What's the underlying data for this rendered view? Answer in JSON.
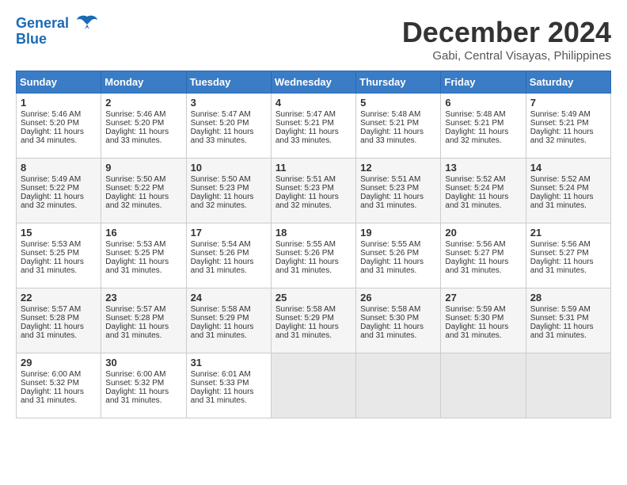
{
  "logo": {
    "line1": "General",
    "line2": "Blue"
  },
  "title": "December 2024",
  "location": "Gabi, Central Visayas, Philippines",
  "headers": [
    "Sunday",
    "Monday",
    "Tuesday",
    "Wednesday",
    "Thursday",
    "Friday",
    "Saturday"
  ],
  "weeks": [
    [
      {
        "day": "1",
        "sunrise": "5:46 AM",
        "sunset": "5:20 PM",
        "daylight": "11 hours and 34 minutes."
      },
      {
        "day": "2",
        "sunrise": "5:46 AM",
        "sunset": "5:20 PM",
        "daylight": "11 hours and 33 minutes."
      },
      {
        "day": "3",
        "sunrise": "5:47 AM",
        "sunset": "5:20 PM",
        "daylight": "11 hours and 33 minutes."
      },
      {
        "day": "4",
        "sunrise": "5:47 AM",
        "sunset": "5:21 PM",
        "daylight": "11 hours and 33 minutes."
      },
      {
        "day": "5",
        "sunrise": "5:48 AM",
        "sunset": "5:21 PM",
        "daylight": "11 hours and 33 minutes."
      },
      {
        "day": "6",
        "sunrise": "5:48 AM",
        "sunset": "5:21 PM",
        "daylight": "11 hours and 32 minutes."
      },
      {
        "day": "7",
        "sunrise": "5:49 AM",
        "sunset": "5:21 PM",
        "daylight": "11 hours and 32 minutes."
      }
    ],
    [
      {
        "day": "8",
        "sunrise": "5:49 AM",
        "sunset": "5:22 PM",
        "daylight": "11 hours and 32 minutes."
      },
      {
        "day": "9",
        "sunrise": "5:50 AM",
        "sunset": "5:22 PM",
        "daylight": "11 hours and 32 minutes."
      },
      {
        "day": "10",
        "sunrise": "5:50 AM",
        "sunset": "5:23 PM",
        "daylight": "11 hours and 32 minutes."
      },
      {
        "day": "11",
        "sunrise": "5:51 AM",
        "sunset": "5:23 PM",
        "daylight": "11 hours and 32 minutes."
      },
      {
        "day": "12",
        "sunrise": "5:51 AM",
        "sunset": "5:23 PM",
        "daylight": "11 hours and 31 minutes."
      },
      {
        "day": "13",
        "sunrise": "5:52 AM",
        "sunset": "5:24 PM",
        "daylight": "11 hours and 31 minutes."
      },
      {
        "day": "14",
        "sunrise": "5:52 AM",
        "sunset": "5:24 PM",
        "daylight": "11 hours and 31 minutes."
      }
    ],
    [
      {
        "day": "15",
        "sunrise": "5:53 AM",
        "sunset": "5:25 PM",
        "daylight": "11 hours and 31 minutes."
      },
      {
        "day": "16",
        "sunrise": "5:53 AM",
        "sunset": "5:25 PM",
        "daylight": "11 hours and 31 minutes."
      },
      {
        "day": "17",
        "sunrise": "5:54 AM",
        "sunset": "5:26 PM",
        "daylight": "11 hours and 31 minutes."
      },
      {
        "day": "18",
        "sunrise": "5:55 AM",
        "sunset": "5:26 PM",
        "daylight": "11 hours and 31 minutes."
      },
      {
        "day": "19",
        "sunrise": "5:55 AM",
        "sunset": "5:26 PM",
        "daylight": "11 hours and 31 minutes."
      },
      {
        "day": "20",
        "sunrise": "5:56 AM",
        "sunset": "5:27 PM",
        "daylight": "11 hours and 31 minutes."
      },
      {
        "day": "21",
        "sunrise": "5:56 AM",
        "sunset": "5:27 PM",
        "daylight": "11 hours and 31 minutes."
      }
    ],
    [
      {
        "day": "22",
        "sunrise": "5:57 AM",
        "sunset": "5:28 PM",
        "daylight": "11 hours and 31 minutes."
      },
      {
        "day": "23",
        "sunrise": "5:57 AM",
        "sunset": "5:28 PM",
        "daylight": "11 hours and 31 minutes."
      },
      {
        "day": "24",
        "sunrise": "5:58 AM",
        "sunset": "5:29 PM",
        "daylight": "11 hours and 31 minutes."
      },
      {
        "day": "25",
        "sunrise": "5:58 AM",
        "sunset": "5:29 PM",
        "daylight": "11 hours and 31 minutes."
      },
      {
        "day": "26",
        "sunrise": "5:58 AM",
        "sunset": "5:30 PM",
        "daylight": "11 hours and 31 minutes."
      },
      {
        "day": "27",
        "sunrise": "5:59 AM",
        "sunset": "5:30 PM",
        "daylight": "11 hours and 31 minutes."
      },
      {
        "day": "28",
        "sunrise": "5:59 AM",
        "sunset": "5:31 PM",
        "daylight": "11 hours and 31 minutes."
      }
    ],
    [
      {
        "day": "29",
        "sunrise": "6:00 AM",
        "sunset": "5:32 PM",
        "daylight": "11 hours and 31 minutes."
      },
      {
        "day": "30",
        "sunrise": "6:00 AM",
        "sunset": "5:32 PM",
        "daylight": "11 hours and 31 minutes."
      },
      {
        "day": "31",
        "sunrise": "6:01 AM",
        "sunset": "5:33 PM",
        "daylight": "11 hours and 31 minutes."
      },
      null,
      null,
      null,
      null
    ]
  ],
  "sunrise_label": "Sunrise: ",
  "sunset_label": "Sunset: ",
  "daylight_label": "Daylight: "
}
